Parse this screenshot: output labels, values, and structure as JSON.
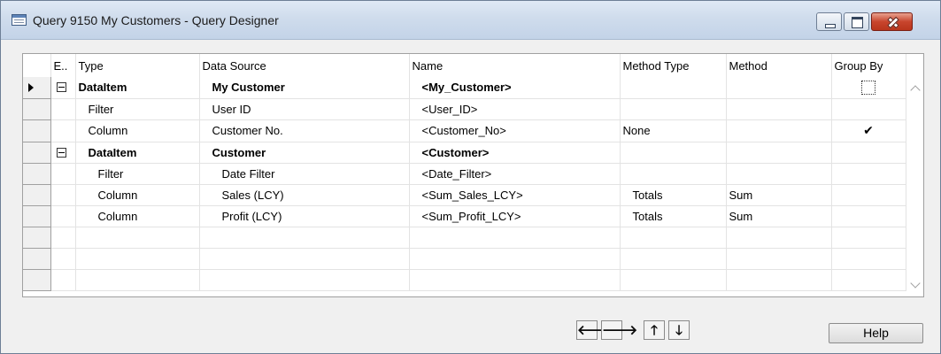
{
  "window": {
    "title": "Query 9150 My Customers - Query Designer"
  },
  "grid": {
    "columns": [
      "E..",
      "Type",
      "Data Source",
      "Name",
      "Method Type",
      "Method",
      "Group By"
    ],
    "rows": [
      {
        "type": "DataItem",
        "data_source": "My Customer",
        "name": "<My_Customer>",
        "method_type": "",
        "method": "",
        "group_by": "unchecked"
      },
      {
        "type": "Filter",
        "data_source": "User ID",
        "name": "<User_ID>",
        "method_type": "",
        "method": "",
        "group_by": ""
      },
      {
        "type": "Column",
        "data_source": "Customer No.",
        "name": "<Customer_No>",
        "method_type": "None",
        "method": "",
        "group_by": "✔"
      },
      {
        "type": "DataItem",
        "data_source": "Customer",
        "name": "<Customer>",
        "method_type": "",
        "method": "",
        "group_by": ""
      },
      {
        "type": "Filter",
        "data_source": "Date Filter",
        "name": "<Date_Filter>",
        "method_type": "",
        "method": "",
        "group_by": ""
      },
      {
        "type": "Column",
        "data_source": "Sales (LCY)",
        "name": "<Sum_Sales_LCY>",
        "method_type": "Totals",
        "method": "Sum",
        "group_by": ""
      },
      {
        "type": "Column",
        "data_source": "Profit (LCY)",
        "name": "<Sum_Profit_LCY>",
        "method_type": "Totals",
        "method": "Sum",
        "group_by": ""
      }
    ]
  },
  "nav_buttons": {
    "left": "🡐",
    "right": "🡒",
    "up": "🡑",
    "down": "🡓"
  },
  "help_label": "Help",
  "icons": {
    "window_icon": "table-window-icon",
    "row_selector": "current-row-arrow-icon",
    "expander": "collapse-minus-icon",
    "check": "checkmark-icon"
  }
}
